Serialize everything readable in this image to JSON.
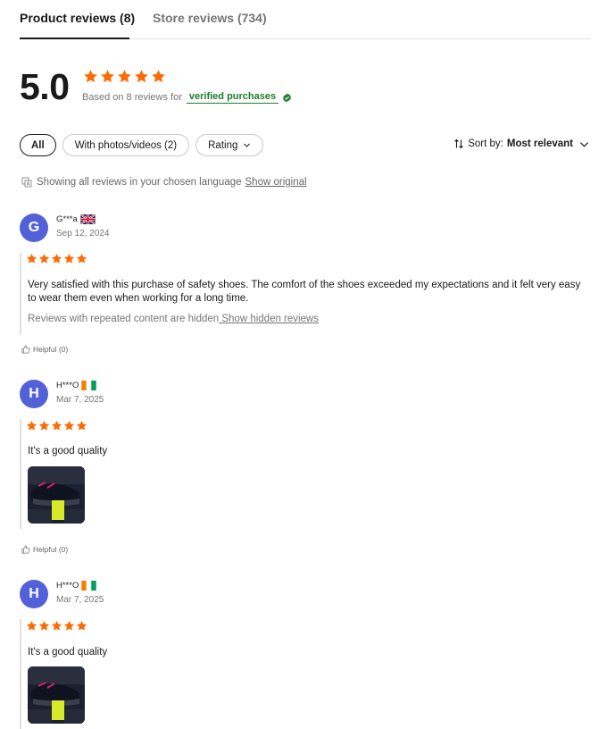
{
  "tabs": [
    {
      "label": "Product reviews (8)"
    },
    {
      "label": "Store reviews (734)"
    }
  ],
  "summary": {
    "score": "5.0",
    "rating_stars": 5,
    "based_on": "Based on 8 reviews for",
    "verified": "verified purchases"
  },
  "filters": [
    {
      "label": "All"
    },
    {
      "label": "With photos/videos (2)"
    },
    {
      "label": "Rating"
    }
  ],
  "sort": {
    "label": "Sort by:",
    "value": "Most relevant"
  },
  "language_notice": {
    "text": "Showing all reviews in your chosen language",
    "link": "Show original"
  },
  "reviews": [
    {
      "initial": "G",
      "name": "G***a",
      "flag": "uk",
      "date": "Sep 12, 2024",
      "stars": 5,
      "text": "Very satisfied with this purchase of safety shoes. The comfort of the shoes exceeded my expectations and it felt very easy to wear them even when working for a long time.",
      "hidden_note": "Reviews with repeated content are hidden",
      "hidden_link": " Show hidden reviews",
      "helpful": "Helpful (0)"
    },
    {
      "initial": "H",
      "name": "H***O",
      "flag": "ci",
      "date": "Mar 7, 2025",
      "stars": 5,
      "text": "It's a good quality",
      "helpful": "Helpful (0)"
    },
    {
      "initial": "H",
      "name": "H***O",
      "flag": "ci",
      "date": "Mar 7, 2025",
      "stars": 5,
      "text": "It's a good quality"
    }
  ],
  "colors": {
    "star": "#fd6a00",
    "verified": "#1e7c2a",
    "avatar": "#5361d8"
  }
}
